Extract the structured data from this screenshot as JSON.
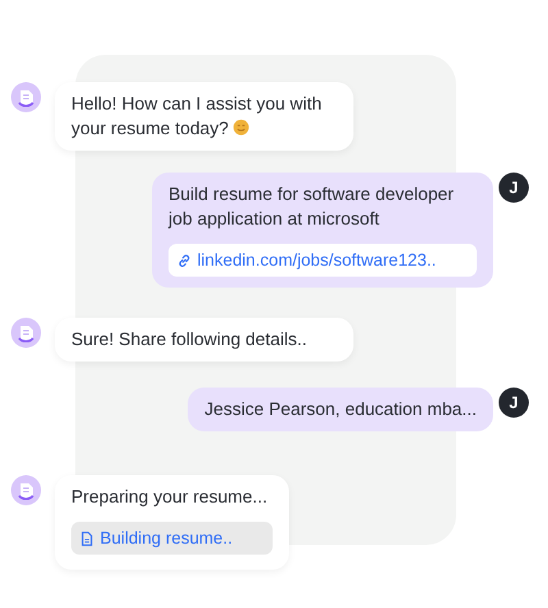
{
  "messages": [
    {
      "kind": "bot",
      "text": "Hello! How can I assist you with your resume today?",
      "emoji": true
    },
    {
      "kind": "user",
      "avatar": "J",
      "text": "Build resume for software developer job application at microsoft",
      "attachment": {
        "kind": "link",
        "text": "linkedin.com/jobs/software123.."
      }
    },
    {
      "kind": "bot",
      "text": "Sure! Share following details.."
    },
    {
      "kind": "user",
      "avatar": "J",
      "text": "Jessice Pearson, education mba..."
    },
    {
      "kind": "bot",
      "text": "Preparing your resume...",
      "attachment": {
        "kind": "file",
        "text": "Building resume.."
      }
    }
  ]
}
